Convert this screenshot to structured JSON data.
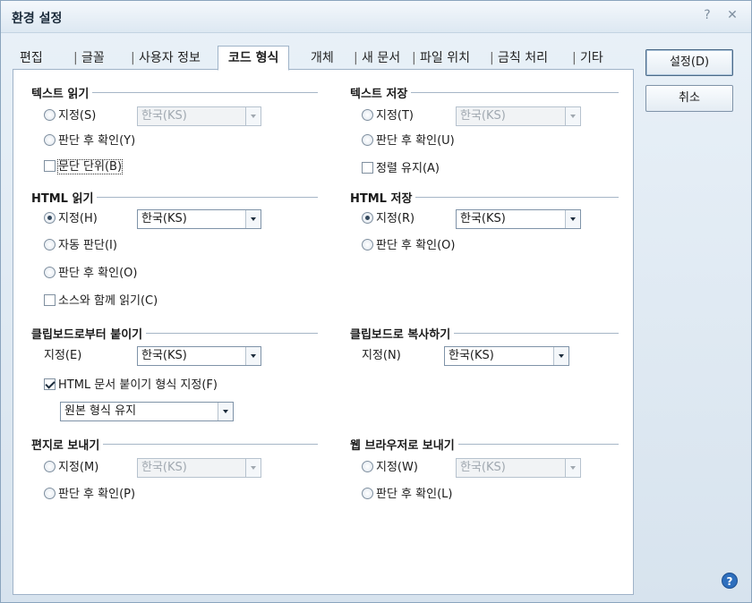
{
  "window": {
    "title": "환경 설정",
    "help_glyph": "?",
    "close_glyph": "✕"
  },
  "tabs": [
    "편집",
    "글꼴",
    "사용자 정보",
    "코드 형식",
    "개체",
    "새 문서",
    "파일 위치",
    "금칙 처리",
    "기타"
  ],
  "active_tab": "코드 형식",
  "buttons": {
    "ok": "설정(D)",
    "cancel": "취소"
  },
  "text_read": {
    "title": "텍스트 읽기",
    "specify": "지정(S)",
    "encoding": "한국(KS)",
    "confirm": "판단 후 확인(Y)",
    "paragraph": "문단 단위(B)"
  },
  "text_save": {
    "title": "텍스트 저장",
    "specify": "지정(T)",
    "encoding": "한국(KS)",
    "confirm": "판단 후 확인(U)",
    "keep_align": "정렬 유지(A)"
  },
  "html_read": {
    "title": "HTML 읽기",
    "specify": "지정(H)",
    "encoding": "한국(KS)",
    "auto": "자동 판단(I)",
    "confirm": "판단 후 확인(O)",
    "with_source": "소스와 함께 읽기(C)"
  },
  "html_save": {
    "title": "HTML 저장",
    "specify": "지정(R)",
    "encoding": "한국(KS)",
    "confirm": "판단 후 확인(O)"
  },
  "clip_paste": {
    "title": "클립보드로부터 붙이기",
    "specify": "지정(E)",
    "encoding": "한국(KS)",
    "html_format": "HTML 문서 붙이기 형식 지정(F)",
    "format_value": "원본 형식 유지"
  },
  "clip_copy": {
    "title": "클립보드로 복사하기",
    "specify": "지정(N)",
    "encoding": "한국(KS)"
  },
  "send_mail": {
    "title": "편지로 보내기",
    "specify": "지정(M)",
    "encoding": "한국(KS)",
    "confirm": "판단 후 확인(P)"
  },
  "send_web": {
    "title": "웹 브라우저로 보내기",
    "specify": "지정(W)",
    "encoding": "한국(KS)",
    "confirm": "판단 후 확인(L)"
  }
}
